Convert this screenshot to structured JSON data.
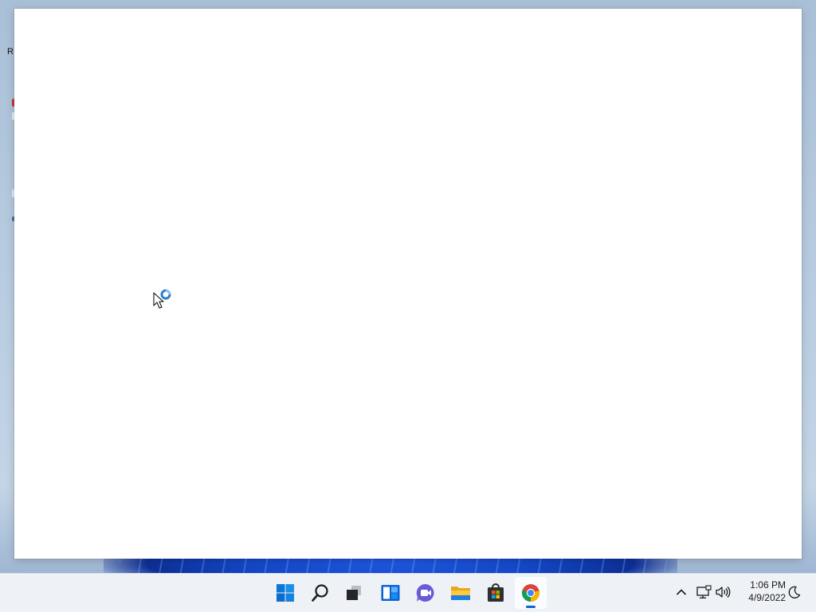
{
  "desktop": {
    "partial_icon_label": "R",
    "wallpaper_accent": "#1447c6"
  },
  "window": {
    "state": "blank",
    "background": "#ffffff"
  },
  "cursor": {
    "kind": "working-in-background",
    "icon": "busy-pointer-icon"
  },
  "taskbar": {
    "items": [
      {
        "name": "Start",
        "icon": "windows-start-icon"
      },
      {
        "name": "Search",
        "icon": "search-icon"
      },
      {
        "name": "Task View",
        "icon": "task-view-icon"
      },
      {
        "name": "Widgets",
        "icon": "widgets-icon"
      },
      {
        "name": "Chat",
        "icon": "chat-icon"
      },
      {
        "name": "File Explorer",
        "icon": "folder-icon"
      },
      {
        "name": "Microsoft Store",
        "icon": "store-icon"
      },
      {
        "name": "Google Chrome",
        "icon": "chrome-icon",
        "active": true
      }
    ],
    "tray": {
      "show_hidden_icon": "chevron-up-icon",
      "network_icon": "network-icon",
      "volume_icon": "volume-icon",
      "notification_icon": "focus-assist-moon-icon"
    },
    "clock": {
      "time": "1:06 PM",
      "date": "4/9/2022"
    },
    "accent": "#0a64d6"
  }
}
